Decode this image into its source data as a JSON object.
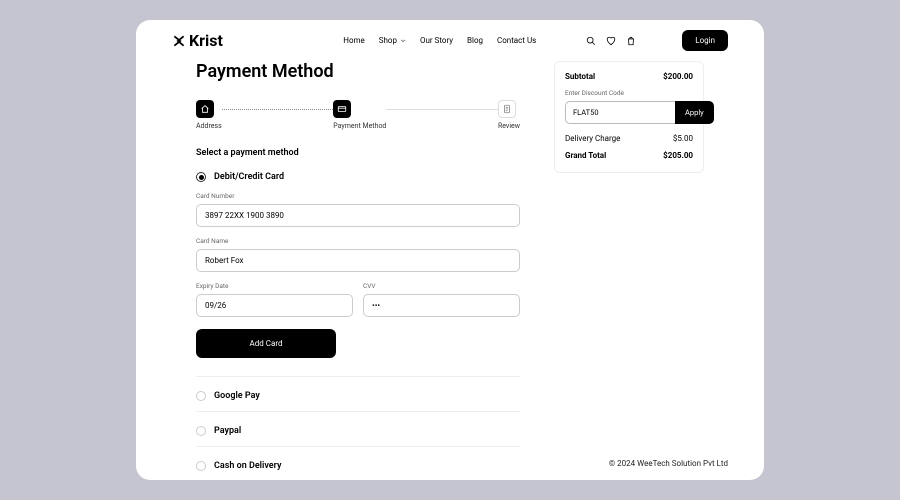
{
  "brand": "Krist",
  "nav": {
    "home": "Home",
    "shop": "Shop",
    "story": "Our Story",
    "blog": "Blog",
    "contact": "Contact Us"
  },
  "loginLabel": "Login",
  "pageTitle": "Payment Method",
  "steps": {
    "address": "Address",
    "payment": "Payment Method",
    "review": "Review"
  },
  "selectLabel": "Select a payment method",
  "methods": {
    "card": "Debit/Credit Card",
    "gpay": "Google Pay",
    "paypal": "Paypal",
    "cod": "Cash on Delivery"
  },
  "card": {
    "numberLabel": "Card Number",
    "numberValue": "3897 22XX 1900 3890",
    "nameLabel": "Card Name",
    "nameValue": "Robert Fox",
    "expiryLabel": "Expiry Date",
    "expiryValue": "09/26",
    "cvvLabel": "CVV",
    "cvvValue": "•••"
  },
  "addCardLabel": "Add Card",
  "summary": {
    "subtotalLabel": "Subtotal",
    "subtotalValue": "$200.00",
    "discountLabel": "Enter Discount Code",
    "discountValue": "FLAT50",
    "applyLabel": "Apply",
    "deliveryLabel": "Delivery Charge",
    "deliveryValue": "$5.00",
    "grandLabel": "Grand Total",
    "grandValue": "$205.00"
  },
  "footer": "© 2024 WeeTech Solution Pvt Ltd"
}
